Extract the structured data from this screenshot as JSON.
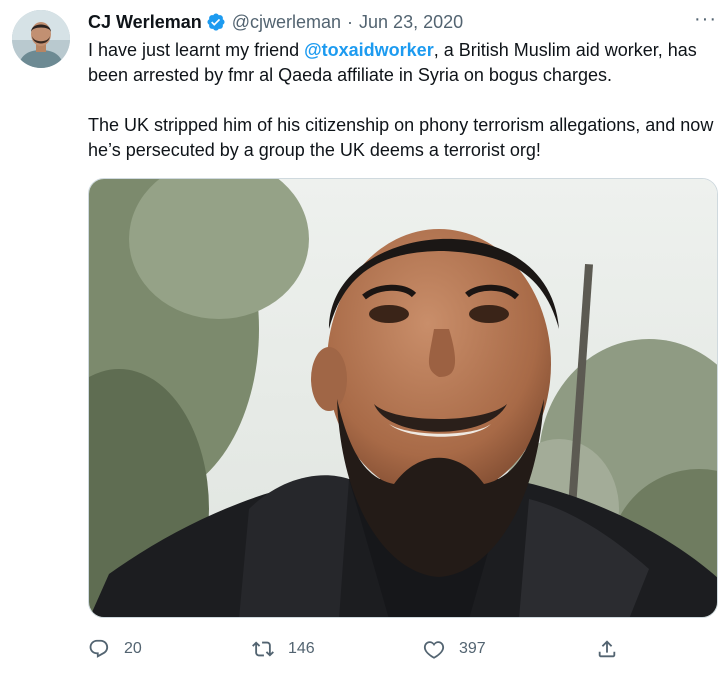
{
  "tweet": {
    "author": {
      "display_name": "CJ Werleman",
      "handle": "@cjwerleman",
      "verified": true
    },
    "separator": "·",
    "date": "Jun 23, 2020",
    "more_label": "···",
    "paragraph1": {
      "before": "I have just learnt my friend ",
      "mention": "@toxaidworker",
      "after": ", a British Muslim aid worker, has been arrested by fmr al Qaeda affiliate in Syria on bogus charges."
    },
    "paragraph2": "The UK stripped him of his citizenship on phony terrorism allegations, and now he’s persecuted by a group the UK deems a terrorist org!",
    "metrics": {
      "replies": "20",
      "retweets": "146",
      "likes": "397"
    },
    "icons": {
      "reply": "reply-icon",
      "retweet": "retweet-icon",
      "like": "like-icon",
      "share": "share-icon",
      "verified": "verified-badge-icon"
    },
    "colors": {
      "link": "#1d9bf0",
      "muted": "#536471",
      "text": "#0f1419"
    }
  }
}
